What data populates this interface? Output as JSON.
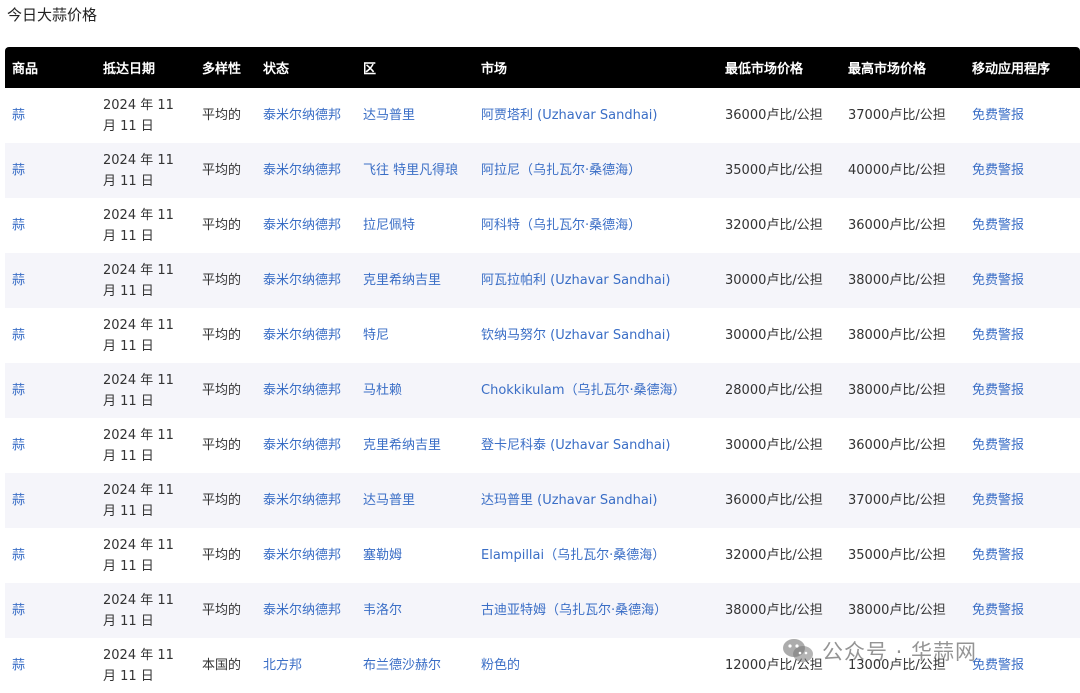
{
  "page": {
    "title": "今日大蒜价格"
  },
  "table": {
    "headers": [
      "商品",
      "抵达日期",
      "多样性",
      "状态",
      "区",
      "市场",
      "最低市场价格",
      "最高市场价格",
      "移动应用程序"
    ],
    "rows": [
      {
        "commodity": "蒜",
        "date": "2024 年 11 月 11 日",
        "variety": "平均的",
        "state": "泰米尔纳德邦",
        "district": "达马普里",
        "market": "阿贾塔利 (Uzhavar Sandhai)",
        "min_price": "36000卢比/公担",
        "max_price": "37000卢比/公担",
        "app": "免费警报"
      },
      {
        "commodity": "蒜",
        "date": "2024 年 11 月 11 日",
        "variety": "平均的",
        "state": "泰米尔纳德邦",
        "district": "飞往 特里凡得琅",
        "market": "阿拉尼（乌扎瓦尔·桑德海）",
        "min_price": "35000卢比/公担",
        "max_price": "40000卢比/公担",
        "app": "免费警报"
      },
      {
        "commodity": "蒜",
        "date": "2024 年 11 月 11 日",
        "variety": "平均的",
        "state": "泰米尔纳德邦",
        "district": "拉尼佩特",
        "market": "阿科特（乌扎瓦尔·桑德海）",
        "min_price": "32000卢比/公担",
        "max_price": "36000卢比/公担",
        "app": "免费警报"
      },
      {
        "commodity": "蒜",
        "date": "2024 年 11 月 11 日",
        "variety": "平均的",
        "state": "泰米尔纳德邦",
        "district": "克里希纳吉里",
        "market": "阿瓦拉帕利 (Uzhavar Sandhai)",
        "min_price": "30000卢比/公担",
        "max_price": "38000卢比/公担",
        "app": "免费警报"
      },
      {
        "commodity": "蒜",
        "date": "2024 年 11 月 11 日",
        "variety": "平均的",
        "state": "泰米尔纳德邦",
        "district": "特尼",
        "market": "钦纳马努尔 (Uzhavar Sandhai)",
        "min_price": "30000卢比/公担",
        "max_price": "38000卢比/公担",
        "app": "免费警报"
      },
      {
        "commodity": "蒜",
        "date": "2024 年 11 月 11 日",
        "variety": "平均的",
        "state": "泰米尔纳德邦",
        "district": "马杜赖",
        "market": "Chokkikulam（乌扎瓦尔·桑德海）",
        "min_price": "28000卢比/公担",
        "max_price": "38000卢比/公担",
        "app": "免费警报"
      },
      {
        "commodity": "蒜",
        "date": "2024 年 11 月 11 日",
        "variety": "平均的",
        "state": "泰米尔纳德邦",
        "district": "克里希纳吉里",
        "market": "登卡尼科泰 (Uzhavar Sandhai)",
        "min_price": "30000卢比/公担",
        "max_price": "36000卢比/公担",
        "app": "免费警报"
      },
      {
        "commodity": "蒜",
        "date": "2024 年 11 月 11 日",
        "variety": "平均的",
        "state": "泰米尔纳德邦",
        "district": "达马普里",
        "market": "达玛普里 (Uzhavar Sandhai)",
        "min_price": "36000卢比/公担",
        "max_price": "37000卢比/公担",
        "app": "免费警报"
      },
      {
        "commodity": "蒜",
        "date": "2024 年 11 月 11 日",
        "variety": "平均的",
        "state": "泰米尔纳德邦",
        "district": "塞勒姆",
        "market": "Elampillai（乌扎瓦尔·桑德海）",
        "min_price": "32000卢比/公担",
        "max_price": "35000卢比/公担",
        "app": "免费警报"
      },
      {
        "commodity": "蒜",
        "date": "2024 年 11 月 11 日",
        "variety": "平均的",
        "state": "泰米尔纳德邦",
        "district": "韦洛尔",
        "market": "古迪亚特姆（乌扎瓦尔·桑德海）",
        "min_price": "38000卢比/公担",
        "max_price": "38000卢比/公担",
        "app": "免费警报"
      },
      {
        "commodity": "蒜",
        "date": "2024 年 11 月 11 日",
        "variety": "本国的",
        "state": "北方邦",
        "district": "布兰德沙赫尔",
        "market": "粉色的",
        "min_price": "12000卢比/公担",
        "max_price": "13000卢比/公担",
        "app": "免费警报"
      }
    ]
  },
  "watermark": {
    "text": "公众号 · 华蒜网",
    "icon": "wechat-icon"
  }
}
